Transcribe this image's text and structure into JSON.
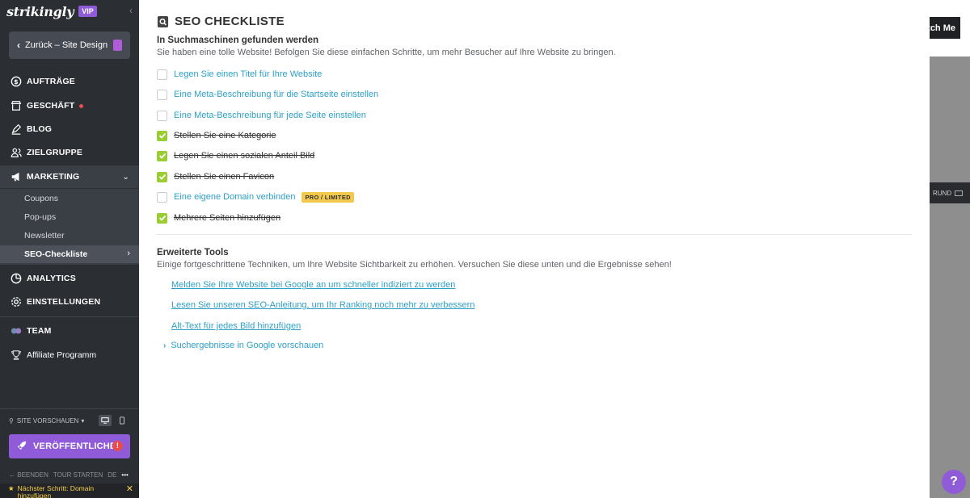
{
  "sidebar": {
    "logo": "strikingly",
    "vip_badge": "VIP",
    "back_label": "Zurück – Site Design",
    "nav": [
      {
        "label": "AUFTRÄGE",
        "icon": "dollar-circle-icon"
      },
      {
        "label": "GESCHÄFT",
        "icon": "store-icon"
      },
      {
        "label": "BLOG",
        "icon": "pen-icon"
      },
      {
        "label": "ZIELGRUPPE",
        "icon": "users-icon"
      },
      {
        "label": "MARKETING",
        "icon": "megaphone-icon"
      },
      {
        "label": "ANALYTICS",
        "icon": "pie-chart-icon"
      },
      {
        "label": "EINSTELLUNGEN",
        "icon": "gear-icon"
      },
      {
        "label": "TEAM",
        "icon": "team-icon"
      },
      {
        "label": "Affiliate Programm",
        "icon": "trophy-icon"
      }
    ],
    "marketing_sub": [
      "Coupons",
      "Pop-ups",
      "Newsletter",
      "SEO-Checkliste"
    ],
    "preview_label": "SITE VORSCHAUEN",
    "publish_label": "VERÖFFENTLICHEN",
    "footer": {
      "exit": "BEENDEN",
      "tour": "TOUR STARTEN",
      "lang": "DE",
      "more": "•••"
    },
    "next_step": "Nächster Schritt: Domain hinzufügen"
  },
  "panel": {
    "title": "SEO CHECKLISTE",
    "section1": {
      "heading": "In Suchmaschinen gefunden werden",
      "description": "Sie haben eine tolle Website! Befolgen Sie diese einfachen Schritte, um mehr Besucher auf Ihre Website zu bringen."
    },
    "checklist": [
      {
        "label": "Legen Sie einen Titel für Ihre Website",
        "checked": false
      },
      {
        "label": "Eine Meta-Beschreibung für die Startseite einstellen",
        "checked": false
      },
      {
        "label": "Eine Meta-Beschreibung für jede Seite einstellen",
        "checked": false
      },
      {
        "label": "Stellen Sie eine Kategorie",
        "checked": true
      },
      {
        "label": "Legen Sie einen sozialen Anteil Bild",
        "checked": true
      },
      {
        "label": "Stellen Sie einen Favicon",
        "checked": true
      },
      {
        "label": "Eine eigene Domain verbinden",
        "checked": false,
        "badge": "PRO / LIMITED"
      },
      {
        "label": "Mehrere Seiten hinzufügen",
        "checked": true
      }
    ],
    "section2": {
      "heading": "Erweiterte Tools",
      "description": "Einige fortgeschrittene Techniken, um Ihre Website Sichtbarkeit zu erhöhen. Versuchen Sie diese unten und die Ergebnisse sehen!"
    },
    "tools": [
      "Melden Sie Ihre Website bei Google an um schneller indiziert zu werden",
      "Lesen Sie unseren SEO-Anleitung, um Ihr Ranking noch mehr zu verbessern",
      "Alt-Text für jedes Bild hinzufügen"
    ],
    "preview_link": "Suchergebnisse in Google vorschauen"
  },
  "editor": {
    "watch_button": "tch Me",
    "bg_bar": "RUND",
    "help": "?"
  },
  "colors": {
    "sidebar_bg": "#2b2e33",
    "accent_purple": "#8f5bd8",
    "link_blue": "#2ea0c7",
    "check_green": "#9acd32",
    "badge_yellow": "#f2c94c"
  }
}
